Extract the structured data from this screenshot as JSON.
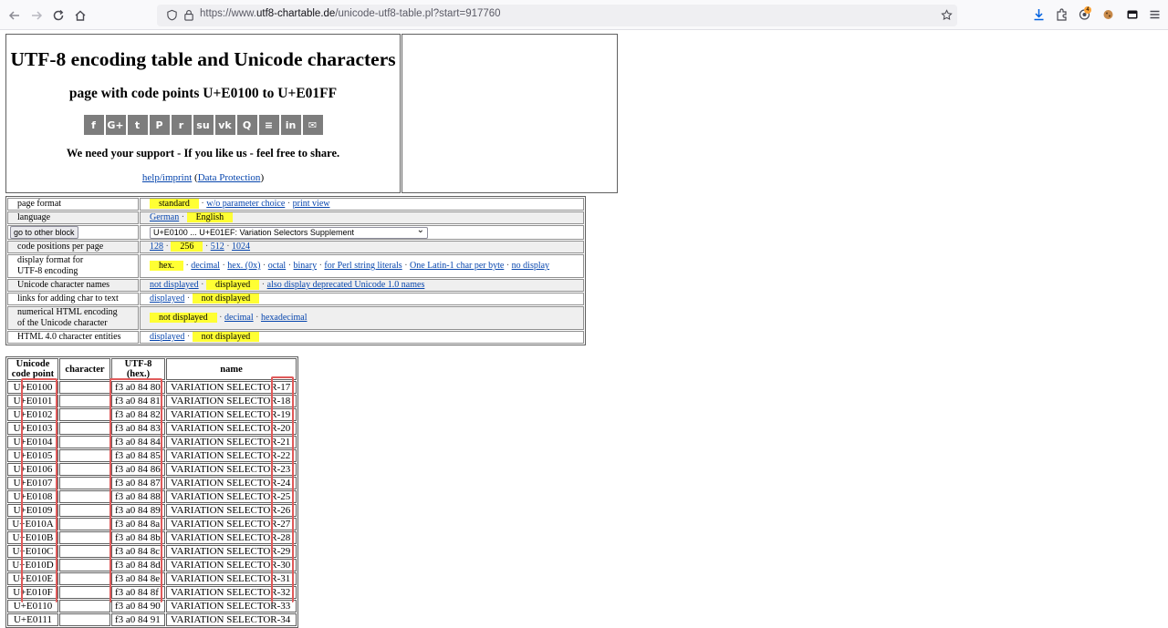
{
  "browser": {
    "url_prefix": "https://www.",
    "url_host": "utf8-chartable.de",
    "url_path": "/unicode-utf8-table.pl?start=917760",
    "extension_badge": "4"
  },
  "header": {
    "title": "UTF-8 encoding table and Unicode characters",
    "subtitle": "page with code points U+E0100 to U+E01FF",
    "share_icons": [
      "facebook-icon",
      "google-plus-icon",
      "twitter-icon",
      "pinterest-icon",
      "reddit-icon",
      "stumbleupon-icon",
      "vk-icon",
      "qzone-icon",
      "buffer-icon",
      "linkedin-icon",
      "mail-icon"
    ],
    "share_glyphs": [
      "f",
      "G+",
      "t",
      "P",
      "r",
      "su",
      "vk",
      "Q",
      "≡",
      "in",
      "✉"
    ],
    "support_text": "We need your support - If you like us - feel free to share.",
    "help_link": "help/imprint",
    "data_protection_link": "Data Protection"
  },
  "settings": {
    "page_format": {
      "label": "page format",
      "current": "standard",
      "opt1": "w/o parameter choice",
      "opt2": "print view"
    },
    "language": {
      "label": "language",
      "opt1": "German",
      "current": "English"
    },
    "block": {
      "button": "go to other block",
      "selected": "U+E0100 ... U+E01EF: Variation Selectors Supplement"
    },
    "code_positions": {
      "label": "code positions per page",
      "opt1": "128",
      "current": "256",
      "opt2": "512",
      "opt3": "1024"
    },
    "display_format": {
      "label_line1": "display format for",
      "label_line2": "UTF-8 encoding",
      "current": "hex.",
      "opt1": "decimal",
      "opt2": "hex. (0x)",
      "opt3": "octal",
      "opt4": "binary",
      "opt5": "for Perl string literals",
      "opt6": "One Latin-1 char per byte",
      "opt7": "no display"
    },
    "char_names": {
      "label": "Unicode character names",
      "opt1": "not displayed",
      "current": "displayed",
      "opt2": "also display deprecated Unicode 1.0 names"
    },
    "links": {
      "label": "links for adding char to text",
      "opt1": "displayed",
      "current": "not displayed"
    },
    "html_encoding": {
      "label_line1": "numerical HTML encoding",
      "label_line2": "of the Unicode character",
      "current": "not displayed",
      "opt1": "decimal",
      "opt2": "hexadecimal"
    },
    "entities": {
      "label": "HTML 4.0 character entities",
      "opt1": "displayed",
      "current": "not displayed"
    }
  },
  "table": {
    "headers": {
      "code_point_1": "Unicode",
      "code_point_2": "code point",
      "character": "character",
      "utf8_1": "UTF-8",
      "utf8_2": "(hex.)",
      "name": "name"
    },
    "rows": [
      {
        "cp": "U+E0100",
        "char": "",
        "utf8": "f3 a0 84 80",
        "name": "VARIATION SELECTOR-17"
      },
      {
        "cp": "U+E0101",
        "char": "",
        "utf8": "f3 a0 84 81",
        "name": "VARIATION SELECTOR-18"
      },
      {
        "cp": "U+E0102",
        "char": "",
        "utf8": "f3 a0 84 82",
        "name": "VARIATION SELECTOR-19"
      },
      {
        "cp": "U+E0103",
        "char": "",
        "utf8": "f3 a0 84 83",
        "name": "VARIATION SELECTOR-20"
      },
      {
        "cp": "U+E0104",
        "char": "",
        "utf8": "f3 a0 84 84",
        "name": "VARIATION SELECTOR-21"
      },
      {
        "cp": "U+E0105",
        "char": "",
        "utf8": "f3 a0 84 85",
        "name": "VARIATION SELECTOR-22"
      },
      {
        "cp": "U+E0106",
        "char": "",
        "utf8": "f3 a0 84 86",
        "name": "VARIATION SELECTOR-23"
      },
      {
        "cp": "U+E0107",
        "char": "",
        "utf8": "f3 a0 84 87",
        "name": "VARIATION SELECTOR-24"
      },
      {
        "cp": "U+E0108",
        "char": "",
        "utf8": "f3 a0 84 88",
        "name": "VARIATION SELECTOR-25"
      },
      {
        "cp": "U+E0109",
        "char": "",
        "utf8": "f3 a0 84 89",
        "name": "VARIATION SELECTOR-26"
      },
      {
        "cp": "U+E010A",
        "char": "",
        "utf8": "f3 a0 84 8a",
        "name": "VARIATION SELECTOR-27"
      },
      {
        "cp": "U+E010B",
        "char": "",
        "utf8": "f3 a0 84 8b",
        "name": "VARIATION SELECTOR-28"
      },
      {
        "cp": "U+E010C",
        "char": "",
        "utf8": "f3 a0 84 8c",
        "name": "VARIATION SELECTOR-29"
      },
      {
        "cp": "U+E010D",
        "char": "",
        "utf8": "f3 a0 84 8d",
        "name": "VARIATION SELECTOR-30"
      },
      {
        "cp": "U+E010E",
        "char": "",
        "utf8": "f3 a0 84 8e",
        "name": "VARIATION SELECTOR-31"
      },
      {
        "cp": "U+E010F",
        "char": "",
        "utf8": "f3 a0 84 8f",
        "name": "VARIATION SELECTOR-32"
      },
      {
        "cp": "U+E0110",
        "char": "",
        "utf8": "f3 a0 84 90",
        "name": "VARIATION SELECTOR-33"
      },
      {
        "cp": "U+E0111",
        "char": "",
        "utf8": "f3 a0 84 91",
        "name": "VARIATION SELECTOR-34"
      }
    ]
  }
}
